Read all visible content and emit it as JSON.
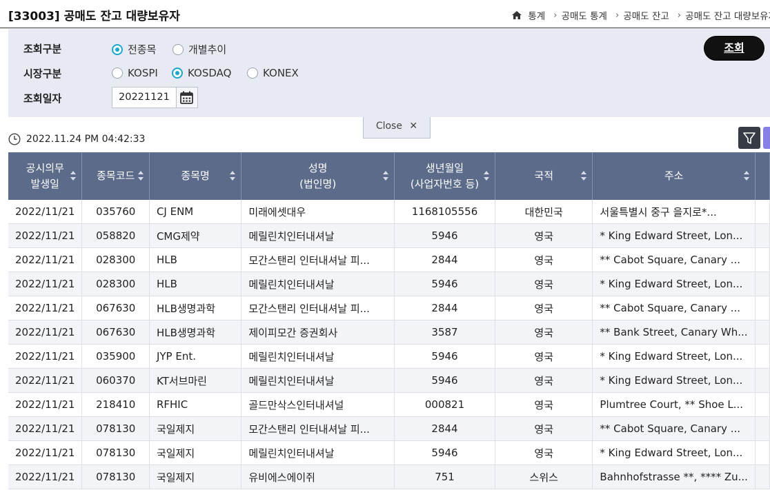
{
  "header": {
    "title": "[33003] 공매도 잔고 대량보유자",
    "breadcrumb": [
      "통계",
      "공매도 통계",
      "공매도 잔고",
      "공매도 잔고 대량보유자"
    ]
  },
  "search": {
    "query_type_label": "조회구분",
    "query_type_options": [
      "전종목",
      "개별추이"
    ],
    "query_type_selected": "전종목",
    "market_label": "시장구분",
    "market_options": [
      "KOSPI",
      "KOSDAQ",
      "KONEX"
    ],
    "market_selected": "KOSDAQ",
    "date_label": "조회일자",
    "date_value": "20221121",
    "query_button": "조회"
  },
  "close_tab": "Close",
  "timestamp": "2022.11.24 PM 04:42:33",
  "table": {
    "headers": [
      [
        "공시의무",
        "발생일"
      ],
      [
        "종목코드"
      ],
      [
        "종목명"
      ],
      [
        "성명",
        "(법인명)"
      ],
      [
        "생년월일",
        "(사업자번호 등)"
      ],
      [
        "국적"
      ],
      [
        "주소"
      ]
    ],
    "rows": [
      [
        "2022/11/21",
        "035760",
        "CJ ENM",
        "미래에셋대우",
        "1168105556",
        "대한민국",
        "서울특별시 중구 을지로*..."
      ],
      [
        "2022/11/21",
        "058820",
        "CMG제약",
        "메릴린치인터내셔날",
        "5946",
        "영국",
        "* King Edward Street, Lon..."
      ],
      [
        "2022/11/21",
        "028300",
        "HLB",
        "모간스탠리 인터내셔날 피...",
        "2844",
        "영국",
        "** Cabot Square, Canary ..."
      ],
      [
        "2022/11/21",
        "028300",
        "HLB",
        "메릴린치인터내셔날",
        "5946",
        "영국",
        "* King Edward Street, Lon..."
      ],
      [
        "2022/11/21",
        "067630",
        "HLB생명과학",
        "모간스탠리 인터내셔날 피...",
        "2844",
        "영국",
        "** Cabot Square, Canary ..."
      ],
      [
        "2022/11/21",
        "067630",
        "HLB생명과학",
        "제이피모간 증권회사",
        "3587",
        "영국",
        "** Bank Street, Canary Wh..."
      ],
      [
        "2022/11/21",
        "035900",
        "JYP Ent.",
        "메릴린치인터내셔날",
        "5946",
        "영국",
        "* King Edward Street, Lon..."
      ],
      [
        "2022/11/21",
        "060370",
        "KT서브마린",
        "메릴린치인터내셔날",
        "5946",
        "영국",
        "* King Edward Street, Lon..."
      ],
      [
        "2022/11/21",
        "218410",
        "RFHIC",
        "골드만삭스인터내셔널",
        "000821",
        "영국",
        "Plumtree Court, ** Shoe L..."
      ],
      [
        "2022/11/21",
        "078130",
        "국일제지",
        "모간스탠리 인터내셔날 피...",
        "2844",
        "영국",
        "** Cabot Square, Canary ..."
      ],
      [
        "2022/11/21",
        "078130",
        "국일제지",
        "메릴린치인터내셔날",
        "5946",
        "영국",
        "* King Edward Street, Lon..."
      ],
      [
        "2022/11/21",
        "078130",
        "국일제지",
        "유비에스에이쥐",
        "751",
        "스위스",
        "Bahnhofstrasse **, **** Zu..."
      ]
    ]
  },
  "colors": {
    "header_bg": "#5c6b8a",
    "panel_bg": "#e7eaf3",
    "radio_accent": "#1aa6c9",
    "query_button_bg": "#111111"
  }
}
